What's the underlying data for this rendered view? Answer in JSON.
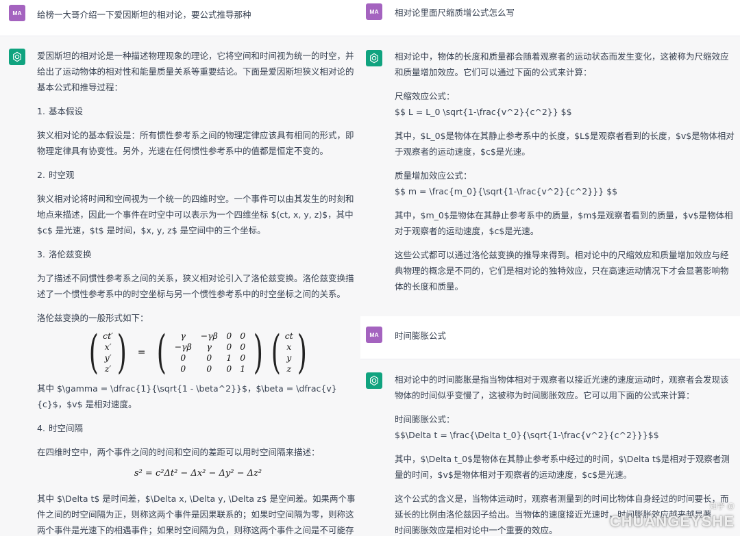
{
  "left": {
    "user_avatar": "MA",
    "user_prompt": "给榜一大哥介绍一下爱因斯坦的相对论，要公式推导那种",
    "intro": "爱因斯坦的相对论是一种描述物理现象的理论，它将空间和时间视为统一的时空，并给出了运动物体的相对性和能量质量关系等重要结论。下面是爱因斯坦狭义相对论的基本公式和推导过程：",
    "s1_num": "1.",
    "s1_title": "基本假设",
    "s1_body": "狭义相对论的基本假设是：所有惯性参考系之间的物理定律应该具有相同的形式，即物理定律具有协变性。另外，光速在任何惯性参考系中的值都是恒定不变的。",
    "s2_num": "2.",
    "s2_title": "时空观",
    "s2_body": "狭义相对论将时间和空间视为一个统一的四维时空。一个事件可以由其发生的时刻和地点来描述，因此一个事件在时空中可以表示为一个四维坐标 $(ct, x, y, z)$，其中 $c$ 是光速，$t$ 是时间，$x, y, z$ 是空间中的三个坐标。",
    "s3_num": "3.",
    "s3_title": "洛伦兹变换",
    "s3_body": "为了描述不同惯性参考系之间的关系，狭义相对论引入了洛伦兹变换。洛伦兹变换描述了一个惯性参考系中的时空坐标与另一个惯性参考系中的时空坐标之间的关系。",
    "s3_lead": "洛伦兹变换的一般形式如下：",
    "matrix": {
      "lhs": [
        "ct′",
        "x′",
        "y′",
        "z′"
      ],
      "eq": "=",
      "cells": [
        "γ",
        "−γβ",
        "0",
        "0",
        "−γβ",
        "γ",
        "0",
        "0",
        "0",
        "0",
        "1",
        "0",
        "0",
        "0",
        "0",
        "1"
      ],
      "rhs": [
        "ct",
        "x",
        "y",
        "z"
      ]
    },
    "s3_where": "其中 $\\gamma = \\dfrac{1}{\\sqrt{1 - \\beta^2}}$，$\\beta = \\dfrac{v}{c}$，$v$ 是相对速度。",
    "s4_num": "4.",
    "s4_title": "时空间隔",
    "s4_body": "在四维时空中，两个事件之间的时间和空间的差距可以用时空间隔来描述：",
    "s4_formula": "s² = c²Δt² − Δx² − Δy² − Δz²",
    "s4_where": "其中 $\\Delta t$ 是时间差，$\\Delta x, \\Delta y, \\Delta z$ 是空间差。如果两个事件之间的时空间隔为正，则称这两个事件是因果联系的；如果时空间隔为零，则称这两个事件是光速下的相遇事件；如果时空间隔为负，则称这两个事件之间是不可能存在的。"
  },
  "right": {
    "user_avatar": "MA",
    "user_prompt_1": "相对论里面尺缩质增公式怎么写",
    "a1_intro": "相对论中，物体的长度和质量都会随着观察者的运动状态而发生变化，这被称为尺缩效应和质量增加效应。它们可以通过下面的公式来计算：",
    "a1_len_title": "尺缩效应公式：",
    "a1_len_formula": "$$ L = L_0 \\sqrt{1-\\frac{v^2}{c^2}} $$",
    "a1_len_where": "其中，$L_0$是物体在其静止参考系中的长度，$L$是观察者看到的长度，$v$是物体相对于观察者的运动速度，$c$是光速。",
    "a1_mass_title": "质量增加效应公式：",
    "a1_mass_formula": "$$ m = \\frac{m_0}{\\sqrt{1-\\frac{v^2}{c^2}}} $$",
    "a1_mass_where": "其中，$m_0$是物体在其静止参考系中的质量，$m$是观察者看到的质量，$v$是物体相对于观察者的运动速度，$c$是光速。",
    "a1_summary": "这些公式都可以通过洛伦兹变换的推导来得到。相对论中的尺缩效应和质量增加效应与经典物理的概念是不同的，它们是相对论的独特效应，只在高速运动情况下才会显著影响物体的长度和质量。",
    "user_prompt_2": "时间膨胀公式",
    "a2_intro": "相对论中的时间膨胀是指当物体相对于观察者以接近光速的速度运动时，观察者会发现该物体的时间似乎变慢了，这被称为时间膨胀效应。它可以用下面的公式来计算：",
    "a2_title": "时间膨胀公式：",
    "a2_formula": "$$\\Delta t = \\frac{\\Delta t_0}{\\sqrt{1-\\frac{v^2}{c^2}}}$$",
    "a2_where": "其中，$\\Delta t_0$是物体在其静止参考系中经过的时间，$\\Delta t$是相对于观察者测量的时间，$v$是物体相对于观察者的运动速度，$c$是光速。",
    "a2_meaning_1": "这个公式的含义是，当物体运动时，观察者测量到的时间比物体自身经过的时间要长，而",
    "a2_meaning_2": "延长的比例由洛伦兹因子给出。当物体的速度接近光速时，时间膨胀效应越来越显著，",
    "a2_meaning_3": "时间膨胀效应是相对论中一个重要的效应。",
    "watermark_1": "知乎 @",
    "watermark_2": "CHUANGEYSHE"
  },
  "colors": {
    "user_avatar_bg": "#a463bf",
    "gpt_avatar_bg": "#10a37f",
    "assistant_bg": "#f7f7f8",
    "text": "#374151"
  }
}
